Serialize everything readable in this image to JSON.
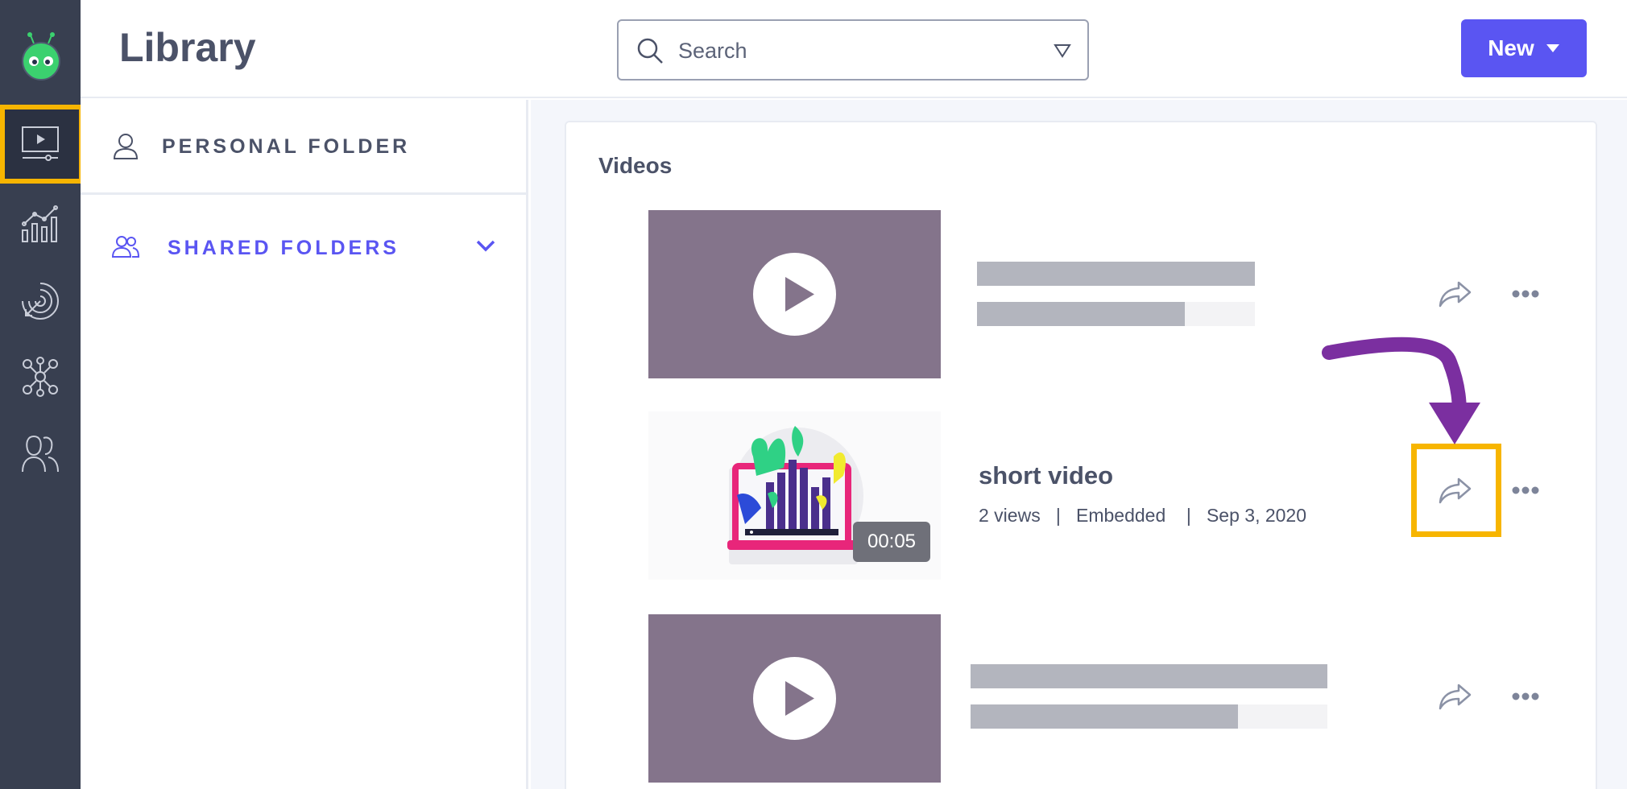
{
  "header": {
    "title": "Library",
    "search_placeholder": "Search",
    "new_button_label": "New"
  },
  "rail": {
    "items": [
      {
        "icon": "video-library-icon",
        "active": true
      },
      {
        "icon": "analytics-icon",
        "active": false
      },
      {
        "icon": "target-icon",
        "active": false
      },
      {
        "icon": "integrations-icon",
        "active": false
      },
      {
        "icon": "users-icon",
        "active": false
      }
    ]
  },
  "folders": {
    "personal_label": "PERSONAL FOLDER",
    "shared_label": "SHARED FOLDERS"
  },
  "content": {
    "section_title": "Videos",
    "videos": [
      {
        "placeholder": true
      },
      {
        "placeholder": false,
        "title": "short video",
        "meta": "2 views   |   Embedded    |   Sep 3, 2020",
        "duration": "00:05"
      },
      {
        "placeholder": true
      }
    ]
  },
  "colors": {
    "rail_bg": "#383f50",
    "accent": "#5a55f2",
    "highlight": "#f7b500",
    "annotation_arrow": "#7b2fa0",
    "placeholder_thumb": "#84748b"
  }
}
